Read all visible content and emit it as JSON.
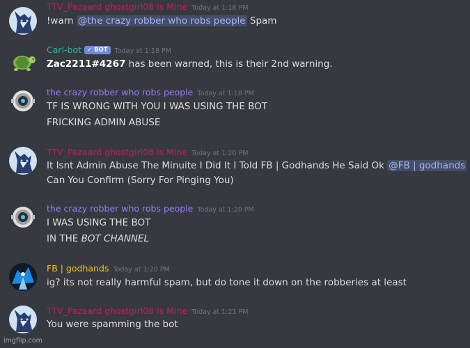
{
  "messages": [
    {
      "author": "TTV_Pazaard ghostgirl08 Is Mine",
      "timestamp": "Today at 1:18 PM",
      "line1_pre": "!warn ",
      "line1_mention": "@the crazy robber who robs people",
      "line1_post": " Spam"
    },
    {
      "author": "Carl-bot",
      "bot_tag": "✓ BOT",
      "timestamp": "Today at 1:18 PM",
      "line1_bold": "Zac2211#4267",
      "line1_post": " has been warned, this is their 2nd warning."
    },
    {
      "author": "the crazy robber who robs people",
      "timestamp": "Today at 1:18 PM",
      "line1": "TF IS WRONG WITH YOU I WAS USING THE BOT",
      "line2": "FRICKING ADMIN ABUSE"
    },
    {
      "author": "TTV_Pazaard ghostgirl08 Is Mine",
      "timestamp": "Today at 1:20 PM",
      "line1_pre": "It Isnt Admin Abuse The Minuite I Did It I Told FB | Godhands He Said Ok ",
      "line1_mention": "@FB | godhands",
      "line2": "Can You Confirm (Sorry For Pinging You)"
    },
    {
      "author": "the crazy robber who robs people",
      "timestamp": "Today at 1:20 PM",
      "line1": "I WAS USING THE BOT",
      "line2_pre": "IN THE ",
      "line2_ital": "BOT CHANNEL"
    },
    {
      "author": "FB | godhands",
      "timestamp": "Today at 1:20 PM",
      "line1": "ig? its not really harmful spam, but do tone it down on the robberies at least"
    },
    {
      "author": "TTV_Pazaard ghostgirl08 Is Mine",
      "timestamp": "Today at 1:21 PM",
      "line1": "You were spamming the bot"
    }
  ],
  "watermark": "imgflip.com",
  "colors": {
    "background": "#36393f",
    "pink_role": "#b42056",
    "teal_bot": "#1abc9c",
    "purple_role": "#9b79ff",
    "gold_role": "#f1c40f",
    "mention": "#a3b7f7"
  },
  "icons": {
    "wolf_avatar": "wolf-avatar-icon",
    "turtle_avatar": "turtle-avatar-icon",
    "robot_avatar": "robot-avatar-icon",
    "mech_avatar": "mech-avatar-icon"
  }
}
